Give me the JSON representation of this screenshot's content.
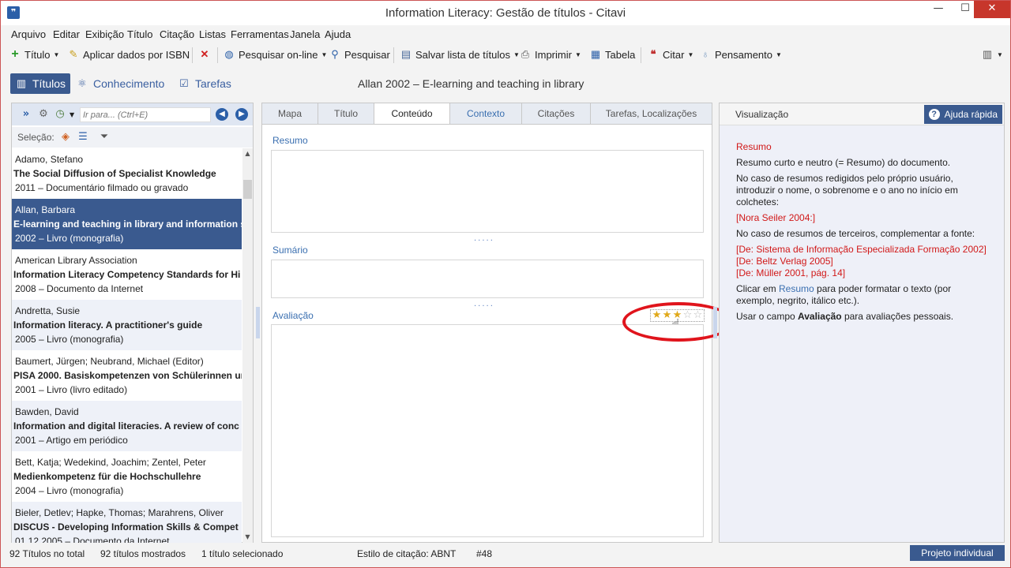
{
  "window": {
    "title": "Information Literacy: Gestão de títulos - Citavi"
  },
  "menu": [
    "Arquivo",
    "Editar",
    "Exibição",
    "Título",
    "Citação",
    "Listas",
    "Ferramentas",
    "Janela",
    "Ajuda"
  ],
  "toolbar": {
    "titulo": "Título",
    "isbn": "Aplicar dados por ISBN",
    "search_online": "Pesquisar on-line",
    "search": "Pesquisar",
    "save_list": "Salvar lista de títulos",
    "print": "Imprimir",
    "table": "Tabela",
    "cite": "Citar",
    "thought": "Pensamento"
  },
  "nav": {
    "titles": "Títulos",
    "knowledge": "Conhecimento",
    "tasks": "Tarefas"
  },
  "current_title": "Allan 2002 – E-learning and teaching in library",
  "search": {
    "placeholder": "Ir para... (Ctrl+E)"
  },
  "selection_label": "Seleção:",
  "titles": [
    {
      "author": "Adamo, Stefano",
      "title": "The Social Diffusion of Specialist Knowledge",
      "meta": "2011 – Documentário filmado ou gravado"
    },
    {
      "author": "Allan, Barbara",
      "title": "E-learning and teaching in library and information s",
      "meta": "2002 – Livro (monografia)"
    },
    {
      "author": "American Library Association",
      "title": "Information Literacy Competency Standards for Hi",
      "meta": "2008 – Documento da Internet"
    },
    {
      "author": "Andretta, Susie",
      "title": "Information literacy. A practitioner's guide",
      "meta": "2005 – Livro (monografia)"
    },
    {
      "author": "Baumert, Jürgen; Neubrand, Michael (Editor)",
      "title": "PISA 2000. Basiskompetenzen von Schülerinnen un",
      "meta": "2001 – Livro (livro editado)"
    },
    {
      "author": "Bawden, David",
      "title": "Information and digital literacies. A review of conc",
      "meta": "2001 – Artigo em periódico"
    },
    {
      "author": "Bett, Katja; Wedekind, Joachim; Zentel, Peter",
      "title": "Medienkompetenz für die Hochschullehre",
      "meta": "2004 – Livro (monografia)"
    },
    {
      "author": "Bieler, Detlev; Hapke, Thomas; Marahrens, Oliver",
      "title": "DISCUS - Developing Information Skills & Compet",
      "meta": "01.12.2005 – Documento da Internet"
    }
  ],
  "tabs": [
    "Mapa",
    "Título",
    "Conteúdo",
    "Contexto",
    "Citações",
    "Tarefas, Localizações"
  ],
  "content": {
    "abstract_label": "Resumo",
    "toc_label": "Sumário",
    "rating_label": "Avaliação",
    "rating": 3,
    "rating_max": 5,
    "dots": "....."
  },
  "preview": {
    "header": "Visualização",
    "help": "Ajuda rápida",
    "heading": "Resumo",
    "p1": "Resumo curto e neutro (= Resumo) do documento.",
    "p2": "No caso de resumos redigidos pelo próprio usuário, introduzir o nome, o sobrenome e o ano no início em colchetes:",
    "ex1": "[Nora Seiler 2004:]",
    "p3": "No caso de resumos de terceiros, complementar a fonte:",
    "ex2": "[De: Sistema de Informação Especializada Formação 2002]",
    "ex3": "[De: Beltz Verlag 2005]",
    "ex4": "[De: Müller 2001, pág. 14]",
    "p4a": "Clicar em ",
    "p4link": "Resumo",
    "p4b": " para poder formatar o texto (por exemplo, negrito, itálico etc.).",
    "p5a": "Usar o campo ",
    "p5b": "Avaliação",
    "p5c": " para avaliações pessoais."
  },
  "status": {
    "total": "92 Títulos no total",
    "shown": "92 títulos mostrados",
    "selected": "1 título selecionado",
    "style": "Estilo de citação: ABNT",
    "num": "#48",
    "project": "Projeto individual"
  },
  "colors": {
    "accent": "#3a5a8f",
    "highlight": "#e0141c",
    "link": "#3a6fb0"
  }
}
